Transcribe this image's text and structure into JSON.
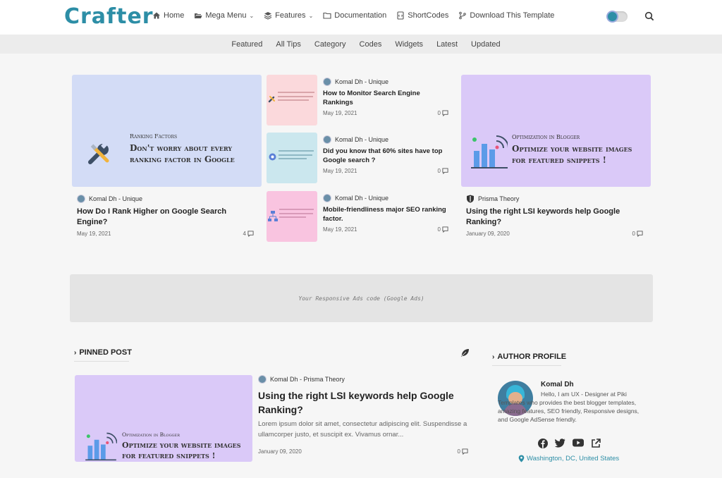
{
  "header": {
    "logo": "Crafter",
    "nav": [
      {
        "label": "Home",
        "icon": "home-icon",
        "dropdown": false
      },
      {
        "label": "Mega Menu",
        "icon": "folder-open-icon",
        "dropdown": true
      },
      {
        "label": "Features",
        "icon": "layers-icon",
        "dropdown": true
      },
      {
        "label": "Documentation",
        "icon": "folder-icon",
        "dropdown": false
      },
      {
        "label": "ShortCodes",
        "icon": "code-file-icon",
        "dropdown": false
      },
      {
        "label": "Download This Template",
        "icon": "branch-icon",
        "dropdown": false
      }
    ]
  },
  "subnav": [
    "Featured",
    "All Tips",
    "Category",
    "Codes",
    "Widgets",
    "Latest",
    "Updated"
  ],
  "featured": {
    "left": {
      "thumb_kicker": "Ranking Factors",
      "thumb_line1": "Don't worry about every",
      "thumb_line2": "ranking factor in Google",
      "author": "Komal Dh - Unique",
      "title": "How Do I Rank Higher on Google Search Engine?",
      "date": "May 19, 2021",
      "comments": "4"
    },
    "middle": [
      {
        "author": "Komal Dh - Unique",
        "title": "How to Monitor Search Engine Rankings",
        "date": "May 19, 2021",
        "comments": "0"
      },
      {
        "author": "Komal Dh - Unique",
        "title": "Did you know that 60% sites have top Google search ?",
        "date": "May 19, 2021",
        "comments": "0"
      },
      {
        "author": "Komal Dh - Unique",
        "title": "Mobile-friendliness major SEO ranking factor.",
        "date": "May 19, 2021",
        "comments": "0"
      }
    ],
    "right": {
      "thumb_kicker": "Optimization in Blogger",
      "thumb_line1": "Optimize your website images",
      "thumb_line2": "for featured snippets !",
      "author": "Prisma Theory",
      "title": "Using the right LSI keywords help Google Ranking?",
      "date": "January 09, 2020",
      "comments": "0"
    }
  },
  "ads_text": "Your Responsive Ads code (Google Ads)",
  "pinned": {
    "heading": "PINNED POST",
    "thumb_kicker": "Optimization in Blogger",
    "thumb_line1": "Optimize your website images",
    "thumb_line2": "for featured snippets !",
    "author": "Komal Dh - Prisma Theory",
    "title": "Using the right LSI keywords help Google Ranking?",
    "excerpt": "Lorem ipsum dolor sit amet, consectetur adipiscing elit. Suspendisse a ullamcorper justo, et suscipit ex. Vivamus ornar...",
    "date": "January 09, 2020",
    "comments": "0"
  },
  "author_profile": {
    "heading": "AUTHOR PROFILE",
    "name": "Komal Dh",
    "bio": "Hello, I am UX - Designer at Piki Templates who provides the best blogger templates, amazing features, SEO friendly, Responsive designs, and Google AdSense friendly.",
    "location": "Washington, DC, United States",
    "socials": [
      "facebook-icon",
      "twitter-icon",
      "youtube-icon",
      "external-link-icon"
    ]
  },
  "colors": {
    "brand": "#2d8ea6",
    "thumb_blue": "#d3dcf6",
    "thumb_purple": "#dac9f8",
    "thumb_pink": "#fbd9dc",
    "thumb_cyan": "#cbe7ee",
    "thumb_magenta": "#f9c4e0"
  }
}
